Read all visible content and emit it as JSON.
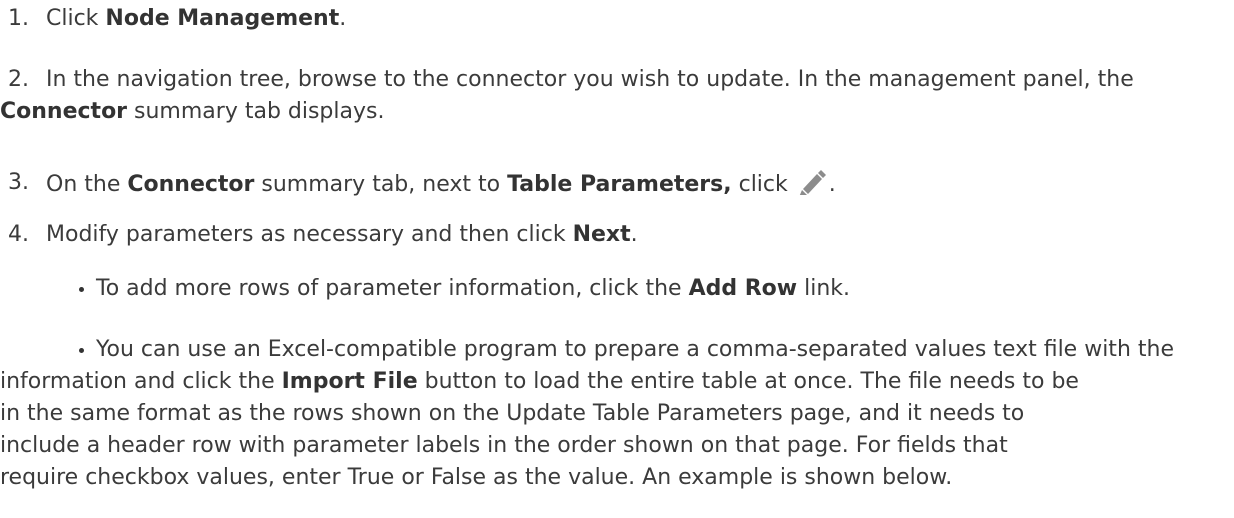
{
  "steps": [
    {
      "num": "1.",
      "pre": "Click ",
      "bold1": "Node Management",
      "post": "."
    },
    {
      "num": "2.",
      "text1": "In the navigation tree, browse to the connector you wish to update. In the management panel, the",
      "bold1": "Connector",
      "text2": " summary tab displays."
    },
    {
      "num": "3.",
      "pre": "On the ",
      "bold1": "Connector",
      "mid": " summary tab, next to ",
      "bold2": "Table Parameters,",
      "post": " click ",
      "icon": "pencil-edit-icon",
      "end": "."
    },
    {
      "num": "4.",
      "pre": "Modify parameters as necessary and then click ",
      "bold1": "Next",
      "post": "."
    }
  ],
  "bullets": [
    {
      "pre": "To add more rows of parameter information, click the ",
      "bold1": "Add Row",
      "post": " link."
    },
    {
      "line1": "You can use an Excel-compatible program to prepare a comma-separated values text file with the",
      "line2_pre": "information and click the ",
      "line2_bold": "Import File",
      "line2_post": " button to load the entire table at once. The file needs to be",
      "line3": "in the same format as the rows shown on the Update Table Parameters page, and it needs to",
      "line4": "include a header row with parameter labels in the order shown on that page. For fields that",
      "line5": "require checkbox values, enter True or False as the value. An example is shown below."
    }
  ],
  "colors": {
    "text": "#3b3b3b",
    "icon": "#8c8c8c"
  }
}
